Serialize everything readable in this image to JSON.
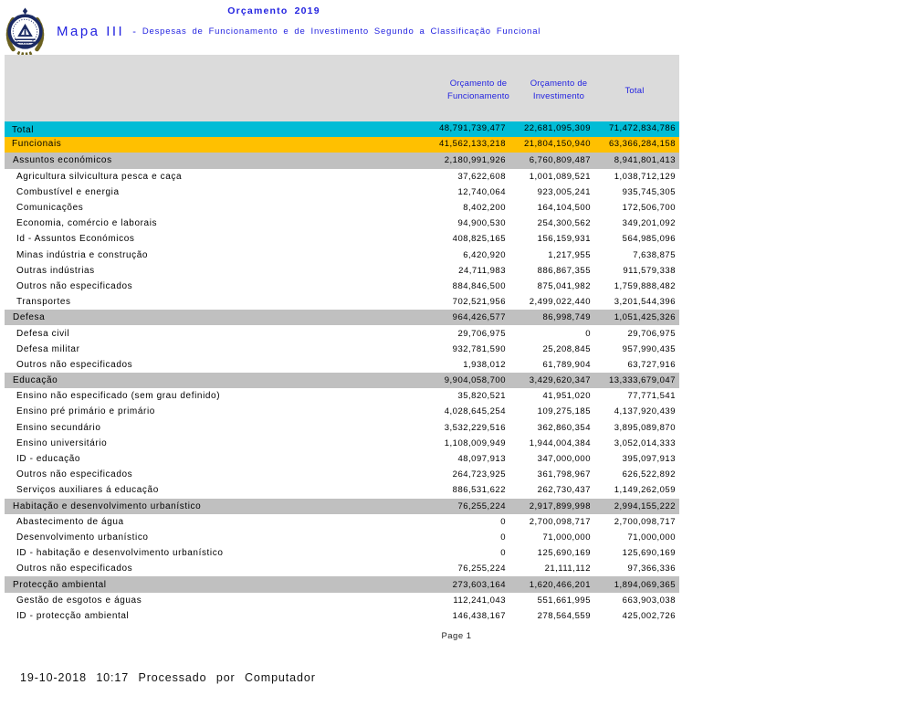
{
  "header": {
    "title": "Orçamento 2019",
    "map_label": "Mapa III",
    "separator": "-",
    "subtitle": "Despesas de Funcionamento e de Investimento Segundo a Classificação Funcional",
    "logo_icon": "cape-verde-national-emblem-icon"
  },
  "table": {
    "columns": [
      "Orçamento de Funcionamento",
      "Orçamento de Investimento",
      "Total"
    ],
    "rows": [
      {
        "type": "total",
        "label": "Total",
        "func": "48,791,739,477",
        "inv": "22,681,095,309",
        "total": "71,472,834,786"
      },
      {
        "type": "funcionais",
        "label": "Funcionais",
        "func": "41,562,133,218",
        "inv": "21,804,150,940",
        "total": "63,366,284,158"
      },
      {
        "type": "section",
        "label": "Assuntos económicos",
        "func": "2,180,991,926",
        "inv": "6,760,809,487",
        "total": "8,941,801,413"
      },
      {
        "type": "detail",
        "label": "Agricultura silvicultura pesca e caça",
        "func": "37,622,608",
        "inv": "1,001,089,521",
        "total": "1,038,712,129"
      },
      {
        "type": "detail",
        "label": "Combustível e energia",
        "func": "12,740,064",
        "inv": "923,005,241",
        "total": "935,745,305"
      },
      {
        "type": "detail",
        "label": "Comunicações",
        "func": "8,402,200",
        "inv": "164,104,500",
        "total": "172,506,700"
      },
      {
        "type": "detail",
        "label": "Economia, comércio e laborais",
        "func": "94,900,530",
        "inv": "254,300,562",
        "total": "349,201,092"
      },
      {
        "type": "detail",
        "label": "Id - Assuntos Económicos",
        "func": "408,825,165",
        "inv": "156,159,931",
        "total": "564,985,096"
      },
      {
        "type": "detail",
        "label": "Minas indústria e construção",
        "func": "6,420,920",
        "inv": "1,217,955",
        "total": "7,638,875"
      },
      {
        "type": "detail",
        "label": "Outras indústrias",
        "func": "24,711,983",
        "inv": "886,867,355",
        "total": "911,579,338"
      },
      {
        "type": "detail",
        "label": "Outros não especificados",
        "func": "884,846,500",
        "inv": "875,041,982",
        "total": "1,759,888,482"
      },
      {
        "type": "detail",
        "label": "Transportes",
        "func": "702,521,956",
        "inv": "2,499,022,440",
        "total": "3,201,544,396"
      },
      {
        "type": "section",
        "label": "Defesa",
        "func": "964,426,577",
        "inv": "86,998,749",
        "total": "1,051,425,326"
      },
      {
        "type": "detail",
        "label": "Defesa civil",
        "func": "29,706,975",
        "inv": "0",
        "total": "29,706,975"
      },
      {
        "type": "detail",
        "label": "Defesa militar",
        "func": "932,781,590",
        "inv": "25,208,845",
        "total": "957,990,435"
      },
      {
        "type": "detail",
        "label": "Outros não especificados",
        "func": "1,938,012",
        "inv": "61,789,904",
        "total": "63,727,916"
      },
      {
        "type": "section",
        "label": "Educação",
        "func": "9,904,058,700",
        "inv": "3,429,620,347",
        "total": "13,333,679,047"
      },
      {
        "type": "detail",
        "label": "Ensino não especificado (sem grau definido)",
        "func": "35,820,521",
        "inv": "41,951,020",
        "total": "77,771,541"
      },
      {
        "type": "detail",
        "label": "Ensino pré primário e primário",
        "func": "4,028,645,254",
        "inv": "109,275,185",
        "total": "4,137,920,439"
      },
      {
        "type": "detail",
        "label": "Ensino secundário",
        "func": "3,532,229,516",
        "inv": "362,860,354",
        "total": "3,895,089,870"
      },
      {
        "type": "detail",
        "label": "Ensino universitário",
        "func": "1,108,009,949",
        "inv": "1,944,004,384",
        "total": "3,052,014,333"
      },
      {
        "type": "detail",
        "label": "ID - educação",
        "func": "48,097,913",
        "inv": "347,000,000",
        "total": "395,097,913"
      },
      {
        "type": "detail",
        "label": "Outros não especificados",
        "func": "264,723,925",
        "inv": "361,798,967",
        "total": "626,522,892"
      },
      {
        "type": "detail",
        "label": "Serviços auxiliares á educação",
        "func": "886,531,622",
        "inv": "262,730,437",
        "total": "1,149,262,059"
      },
      {
        "type": "section",
        "label": "Habitação e desenvolvimento urbanístico",
        "func": "76,255,224",
        "inv": "2,917,899,998",
        "total": "2,994,155,222"
      },
      {
        "type": "detail",
        "label": "Abastecimento de água",
        "func": "0",
        "inv": "2,700,098,717",
        "total": "2,700,098,717"
      },
      {
        "type": "detail",
        "label": "Desenvolvimento urbanístico",
        "func": "0",
        "inv": "71,000,000",
        "total": "71,000,000"
      },
      {
        "type": "detail",
        "label": "ID - habitação e desenvolvimento urbanístico",
        "func": "0",
        "inv": "125,690,169",
        "total": "125,690,169"
      },
      {
        "type": "detail",
        "label": "Outros não especificados",
        "func": "76,255,224",
        "inv": "21,111,112",
        "total": "97,366,336"
      },
      {
        "type": "section",
        "label": "Protecção ambiental",
        "func": "273,603,164",
        "inv": "1,620,466,201",
        "total": "1,894,069,365"
      },
      {
        "type": "detail",
        "label": "Gestão de esgotos e águas",
        "func": "112,241,043",
        "inv": "551,661,995",
        "total": "663,903,038"
      },
      {
        "type": "detail",
        "label": "ID - protecção ambiental",
        "func": "146,438,167",
        "inv": "278,564,559",
        "total": "425,002,726"
      }
    ]
  },
  "footer": {
    "page_label": "Page 1",
    "processed": "19-10-2018 10:17 Processado por Computador"
  },
  "colors": {
    "title_blue": "#2222e0",
    "header_block": "#dbdbdb",
    "total_row": "#00bcd6",
    "funcionais_row": "#ffc000",
    "section_row": "#c0c0c0"
  }
}
